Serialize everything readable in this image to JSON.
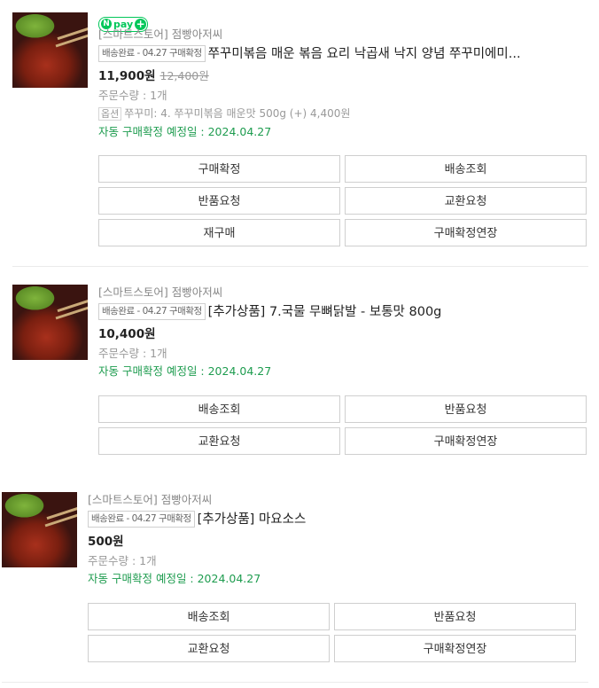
{
  "orders": [
    {
      "badge": {
        "n": "N",
        "text": "pay",
        "plus": "+"
      },
      "store": "[스마트스토어] 점빵아저씨",
      "status": "배송완료 - 04.27 구매확정",
      "product": "쭈꾸미볶음 매운 볶음 요리 낙곱새 낙지 양념 쭈꾸미에미...",
      "price": "11,900원",
      "original_price": "12,400원",
      "quantity": "주문수량 : 1개",
      "option_tag": "옵션",
      "option": "쭈꾸미: 4. 쭈꾸미볶음 매운맛 500g (+) 4,400원",
      "auto_confirm": "자동 구매확정 예정일 : 2024.04.27",
      "buttons": [
        "구매확정",
        "배송조회",
        "반품요청",
        "교환요청",
        "재구매",
        "구매확정연장"
      ]
    },
    {
      "store": "[스마트스토어] 점빵아저씨",
      "status": "배송완료 - 04.27 구매확정",
      "product": "[추가상품] 7.국물 무뼈닭발 - 보통맛 800g",
      "price": "10,400원",
      "quantity": "주문수량 : 1개",
      "auto_confirm": "자동 구매확정 예정일 : 2024.04.27",
      "buttons": [
        "배송조회",
        "반품요청",
        "교환요청",
        "구매확정연장"
      ]
    },
    {
      "store": "[스마트스토어] 점빵아저씨",
      "status": "배송완료 - 04.27 구매확정",
      "product": "[추가상품] 마요소스",
      "price": "500원",
      "quantity": "주문수량 : 1개",
      "auto_confirm": "자동 구매확정 예정일 : 2024.04.27",
      "buttons": [
        "배송조회",
        "반품요청",
        "교환요청",
        "구매확정연장"
      ]
    }
  ],
  "colors": {
    "accent_green": "#03c75a",
    "confirm_text": "#1e9c4f"
  }
}
